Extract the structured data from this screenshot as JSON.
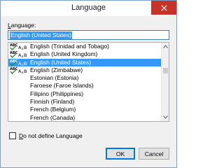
{
  "window": {
    "title": "Language"
  },
  "language_label_prefix": "",
  "language_label_accel": "L",
  "language_label_rest": "anguage:",
  "input": {
    "value": "English (United States)"
  },
  "list": {
    "items": [
      {
        "label": "English (Trinidad and Tobago)",
        "spell": true,
        "selected": false
      },
      {
        "label": "English (United Kingdom)",
        "spell": true,
        "selected": false
      },
      {
        "label": "English (United States)",
        "spell": true,
        "selected": true
      },
      {
        "label": "English (Zimbabwe)",
        "spell": true,
        "selected": false
      },
      {
        "label": "Estonian (Estonia)",
        "spell": false,
        "selected": false
      },
      {
        "label": "Faroese (Faroe Islands)",
        "spell": false,
        "selected": false
      },
      {
        "label": "Filipino (Philippines)",
        "spell": false,
        "selected": false
      },
      {
        "label": "Finnish (Finland)",
        "spell": false,
        "selected": false
      },
      {
        "label": "French (Belgium)",
        "spell": false,
        "selected": false
      },
      {
        "label": "French (Canada)",
        "spell": false,
        "selected": false
      }
    ],
    "scroll_position": 0.3,
    "scroll_visible_fraction": 0.05
  },
  "checkbox": {
    "accel": "D",
    "rest": "o not define Language",
    "checked": false
  },
  "buttons": {
    "ok": "OK",
    "cancel": "Cancel"
  },
  "icons": {
    "close": "close-icon",
    "spell": "spellcheck-abc-icon",
    "up": "scroll-up-arrow-icon",
    "down": "scroll-down-arrow-icon"
  },
  "colors": {
    "selection": "#3399ff",
    "close_button": "#c7322a",
    "spell_check": "#2e8b2e",
    "focus_border": "#0078d7"
  }
}
